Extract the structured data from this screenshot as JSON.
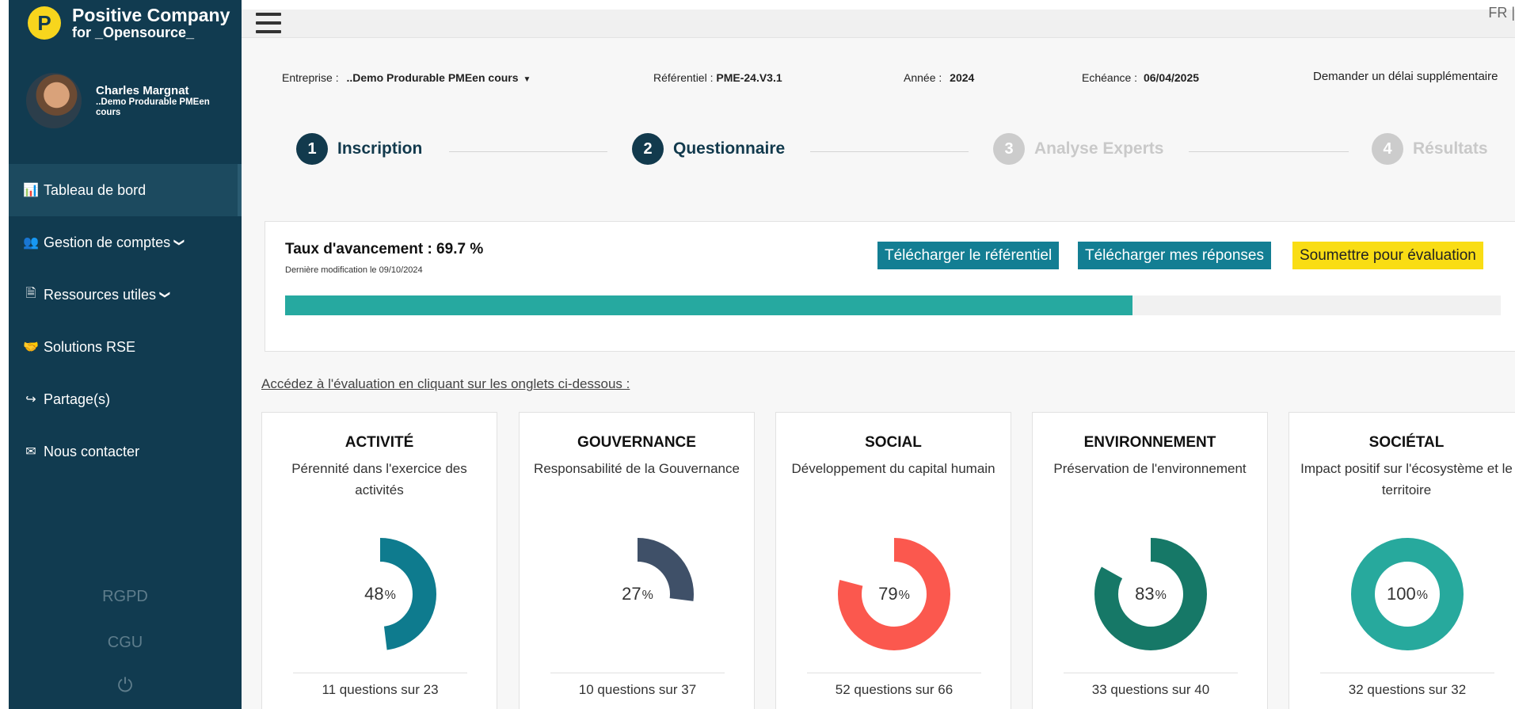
{
  "brand": {
    "logo_letter": "P",
    "name": "Positive Company",
    "sub": "for _Opensource_"
  },
  "user": {
    "name": "Charles Margnat",
    "org": "..Demo Produrable PMEen cours"
  },
  "nav": [
    {
      "key": "dashboard",
      "label": "Tableau de bord",
      "icon": "bar-chart-icon",
      "glyph": "📊",
      "active": true,
      "chevron": false
    },
    {
      "key": "accounts",
      "label": "Gestion de comptes",
      "icon": "users-icon",
      "glyph": "👥",
      "active": false,
      "chevron": true
    },
    {
      "key": "resources",
      "label": "Ressources utiles",
      "icon": "document-icon",
      "glyph": "🗎",
      "active": false,
      "chevron": true
    },
    {
      "key": "rse",
      "label": "Solutions RSE",
      "icon": "handshake-icon",
      "glyph": "🤝",
      "active": false,
      "chevron": false
    },
    {
      "key": "shares",
      "label": "Partage(s)",
      "icon": "share-icon",
      "glyph": "↪",
      "active": false,
      "chevron": false
    },
    {
      "key": "contact",
      "label": "Nous contacter",
      "icon": "mail-icon",
      "glyph": "✉",
      "active": false,
      "chevron": false
    }
  ],
  "footer": {
    "rgpd": "RGPD",
    "cgu": "CGU",
    "power_glyph": "⏻"
  },
  "header": {
    "lang": "FR | "
  },
  "info": {
    "entreprise_label": "Entreprise :",
    "entreprise_value": "..Demo Produrable PMEen cours",
    "referentiel_label": "Référentiel :",
    "referentiel_value": "PME-24.V3.1",
    "annee_label": "Année :",
    "annee_value": "2024",
    "echeance_label": "Echéance :",
    "echeance_value": "06/04/2025",
    "delay_link": "Demander un délai supplémentaire"
  },
  "steps": [
    {
      "num": "1",
      "label": "Inscription",
      "state": "done"
    },
    {
      "num": "2",
      "label": "Questionnaire",
      "state": "done"
    },
    {
      "num": "3",
      "label": "Analyse Experts",
      "state": "todo"
    },
    {
      "num": "4",
      "label": "Résultats",
      "state": "todo"
    }
  ],
  "progress": {
    "title": "Taux d'avancement : 69.7 %",
    "last_modified": "Dernière modification le 09/10/2024",
    "percent": 69.7,
    "bar_color": "#26a9a0",
    "btn_download_ref": "Télécharger le référentiel",
    "btn_download_answers": "Télécharger mes réponses",
    "btn_submit": "Soumettre pour évaluation"
  },
  "hint": "Accédez à l'évaluation en cliquant sur les onglets ci-dessous :",
  "categories": [
    {
      "key": "activite",
      "title": "ACTIVITÉ",
      "desc": "Pérennité dans l'exercice des activités",
      "percent": 48,
      "color": "#0e7b8e",
      "count": "11 questions sur 23"
    },
    {
      "key": "gouvernance",
      "title": "GOUVERNANCE",
      "desc": "Responsabilité de la Gouvernance",
      "percent": 27,
      "color": "#3f5068",
      "count": "10 questions sur 37"
    },
    {
      "key": "social",
      "title": "SOCIAL",
      "desc": "Développement du capital humain",
      "percent": 79,
      "color": "#fb584e",
      "count": "52 questions sur 66"
    },
    {
      "key": "environnement",
      "title": "ENVIRONNEMENT",
      "desc": "Préservation de l'environnement",
      "percent": 83,
      "color": "#167867",
      "count": "33 questions sur 40"
    },
    {
      "key": "societal",
      "title": "SOCIÉTAL",
      "desc": "Impact positif sur l'écosystème et le territoire",
      "percent": 100,
      "color": "#27a99d",
      "count": "32 questions sur 32"
    }
  ]
}
